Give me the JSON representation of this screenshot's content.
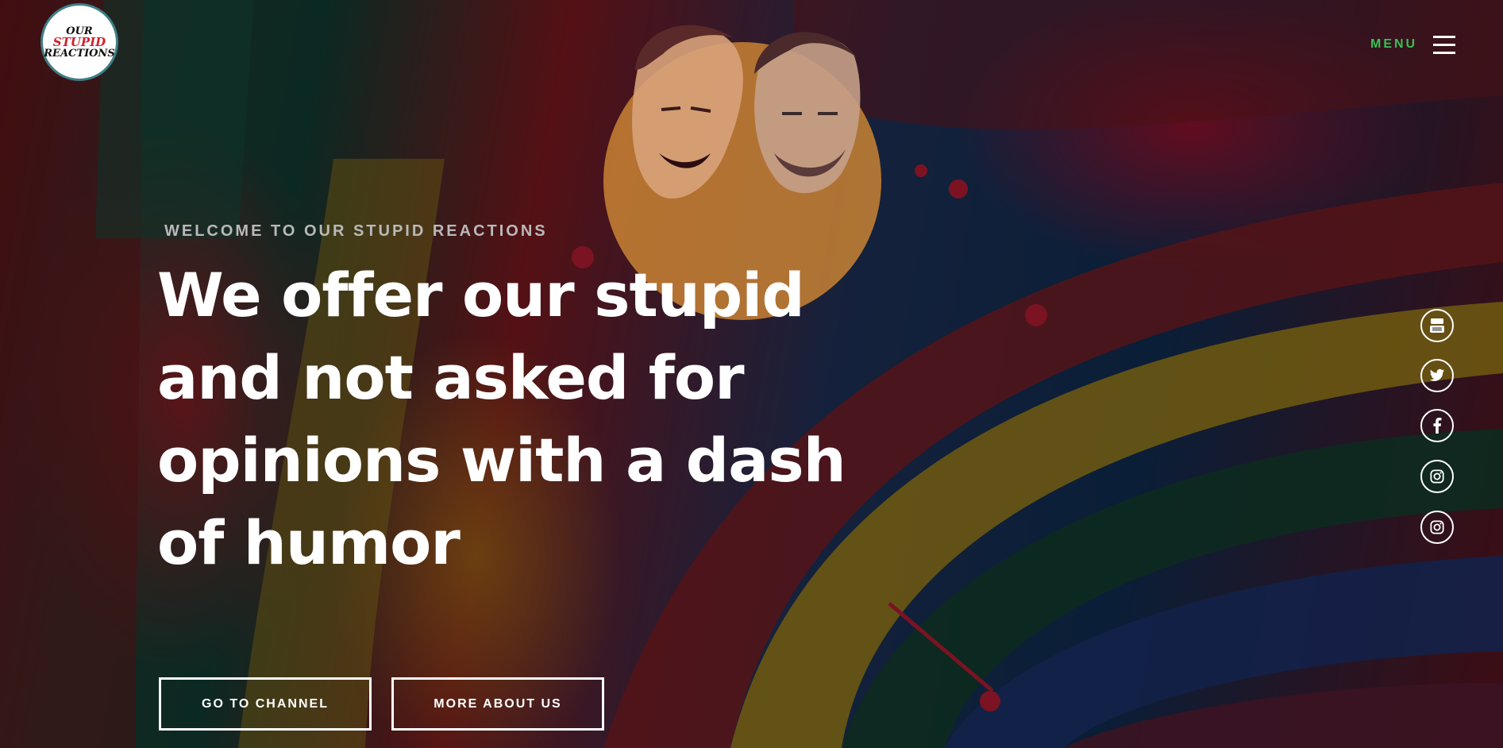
{
  "brand": {
    "logo_line1": "OUR",
    "logo_line2": "STUPID",
    "logo_line3": "REACTIONS"
  },
  "nav": {
    "menu_label": "MENU"
  },
  "hero": {
    "eyebrow": "WELCOME TO OUR STUPID REACTIONS",
    "headline_lines": [
      "We offer our stupid",
      "and not asked for",
      "opinions with a dash",
      "of humor"
    ],
    "buttons": {
      "channel": "GO TO CHANNEL",
      "about": "MORE ABOUT US"
    }
  },
  "social": [
    {
      "icon": "youtube-icon",
      "glyph": "You Tube"
    },
    {
      "icon": "twitter-icon"
    },
    {
      "icon": "facebook-icon"
    },
    {
      "icon": "instagram-icon"
    },
    {
      "icon": "instagram-icon"
    }
  ],
  "colors": {
    "menu_accent": "#36c155",
    "logo_red": "#d1202a",
    "logo_border": "#3d7f86"
  }
}
